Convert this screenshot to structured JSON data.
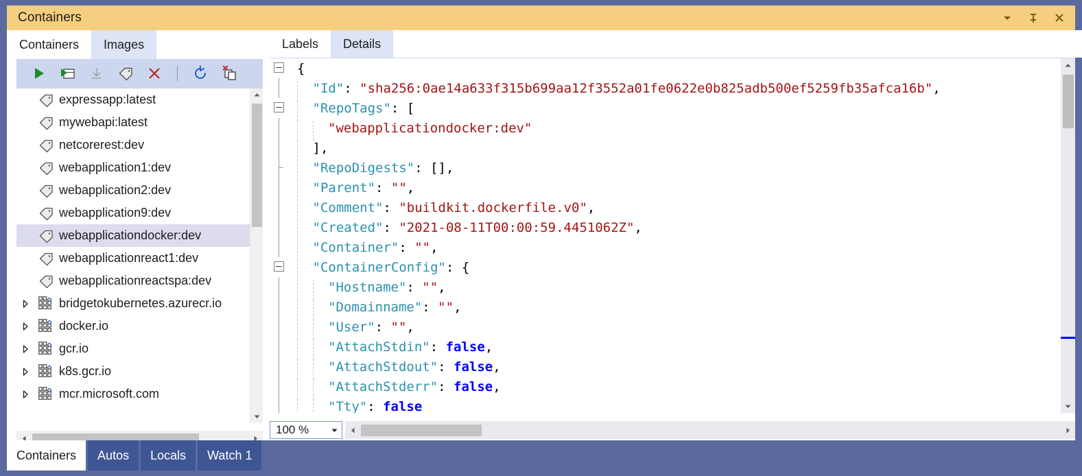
{
  "window": {
    "title": "Containers",
    "buttons": [
      {
        "name": "window-dropdown-button",
        "icon": "chevron-down-icon"
      },
      {
        "name": "window-pin-button",
        "icon": "pin-icon"
      },
      {
        "name": "window-close-button",
        "icon": "close-icon"
      }
    ]
  },
  "left_panel": {
    "tabs": [
      {
        "label": "Containers",
        "selected": false
      },
      {
        "label": "Images",
        "selected": true
      }
    ],
    "toolbar": [
      {
        "name": "run-button",
        "icon": "play-icon",
        "enabled": true
      },
      {
        "name": "open-in-browser-button",
        "icon": "window-play-icon",
        "enabled": true
      },
      {
        "name": "pull-button",
        "icon": "download-icon",
        "enabled": false
      },
      {
        "name": "tag-button",
        "icon": "tag-icon",
        "enabled": true
      },
      {
        "name": "remove-button",
        "icon": "close-x-icon",
        "enabled": true
      },
      {
        "name": "refresh-button",
        "icon": "refresh-icon",
        "enabled": true
      },
      {
        "name": "prune-images-button",
        "icon": "prune-images-icon",
        "enabled": true
      }
    ],
    "tree": [
      {
        "label": "expressapp:latest",
        "icon": "tag-icon",
        "type": "image",
        "expandable": false,
        "selected": false
      },
      {
        "label": "mywebapi:latest",
        "icon": "tag-icon",
        "type": "image",
        "expandable": false,
        "selected": false
      },
      {
        "label": "netcorerest:dev",
        "icon": "tag-icon",
        "type": "image",
        "expandable": false,
        "selected": false
      },
      {
        "label": "webapplication1:dev",
        "icon": "tag-icon",
        "type": "image",
        "expandable": false,
        "selected": false
      },
      {
        "label": "webapplication2:dev",
        "icon": "tag-icon",
        "type": "image",
        "expandable": false,
        "selected": false
      },
      {
        "label": "webapplication9:dev",
        "icon": "tag-icon",
        "type": "image",
        "expandable": false,
        "selected": false
      },
      {
        "label": "webapplicationdocker:dev",
        "icon": "tag-icon",
        "type": "image",
        "expandable": false,
        "selected": true
      },
      {
        "label": "webapplicationreact1:dev",
        "icon": "tag-icon",
        "type": "image",
        "expandable": false,
        "selected": false
      },
      {
        "label": "webapplicationreactspa:dev",
        "icon": "tag-icon",
        "type": "image",
        "expandable": false,
        "selected": false
      },
      {
        "label": "bridgetokubernetes.azurecr.io",
        "icon": "registry-icon",
        "type": "registry",
        "expandable": true,
        "selected": false
      },
      {
        "label": "docker.io",
        "icon": "registry-icon",
        "type": "registry",
        "expandable": true,
        "selected": false
      },
      {
        "label": "gcr.io",
        "icon": "registry-icon",
        "type": "registry",
        "expandable": true,
        "selected": false
      },
      {
        "label": "k8s.gcr.io",
        "icon": "registry-icon",
        "type": "registry",
        "expandable": true,
        "selected": false
      },
      {
        "label": "mcr.microsoft.com",
        "icon": "registry-icon",
        "type": "registry",
        "expandable": true,
        "selected": false
      }
    ]
  },
  "right_panel": {
    "tabs": [
      {
        "label": "Labels",
        "selected": false
      },
      {
        "label": "Details",
        "selected": true
      }
    ],
    "zoom_level": "100 %",
    "code_lines": [
      {
        "fold": "open",
        "indent": 0,
        "tokens": [
          {
            "t": "{",
            "c": "p"
          }
        ]
      },
      {
        "fold": "line",
        "indent": 1,
        "tokens": [
          {
            "t": "\"Id\"",
            "c": "k"
          },
          {
            "t": ": ",
            "c": "p"
          },
          {
            "t": "\"sha256:0ae14a633f315b699aa12f3552a01fe0622e0b825adb500ef5259fb35afca16b\"",
            "c": "s"
          },
          {
            "t": ",",
            "c": "p"
          }
        ]
      },
      {
        "fold": "open",
        "indent": 1,
        "tokens": [
          {
            "t": "\"RepoTags\"",
            "c": "k"
          },
          {
            "t": ": [",
            "c": "p"
          }
        ]
      },
      {
        "fold": "line",
        "indent": 2,
        "tokens": [
          {
            "t": "\"webapplicationdocker:dev\"",
            "c": "s"
          }
        ]
      },
      {
        "fold": "line",
        "indent": 1,
        "tokens": [
          {
            "t": "],",
            "c": "p"
          }
        ]
      },
      {
        "fold": "stub",
        "indent": 1,
        "tokens": [
          {
            "t": "\"RepoDigests\"",
            "c": "k"
          },
          {
            "t": ": [],",
            "c": "p"
          }
        ]
      },
      {
        "fold": "line",
        "indent": 1,
        "tokens": [
          {
            "t": "\"Parent\"",
            "c": "k"
          },
          {
            "t": ": ",
            "c": "p"
          },
          {
            "t": "\"\"",
            "c": "s"
          },
          {
            "t": ",",
            "c": "p"
          }
        ]
      },
      {
        "fold": "line",
        "indent": 1,
        "tokens": [
          {
            "t": "\"Comment\"",
            "c": "k"
          },
          {
            "t": ": ",
            "c": "p"
          },
          {
            "t": "\"buildkit.dockerfile.v0\"",
            "c": "s"
          },
          {
            "t": ",",
            "c": "p"
          }
        ]
      },
      {
        "fold": "line",
        "indent": 1,
        "tokens": [
          {
            "t": "\"Created\"",
            "c": "k"
          },
          {
            "t": ": ",
            "c": "p"
          },
          {
            "t": "\"2021-08-11T00:00:59.4451062Z\"",
            "c": "s"
          },
          {
            "t": ",",
            "c": "p"
          }
        ]
      },
      {
        "fold": "line",
        "indent": 1,
        "tokens": [
          {
            "t": "\"Container\"",
            "c": "k"
          },
          {
            "t": ": ",
            "c": "p"
          },
          {
            "t": "\"\"",
            "c": "s"
          },
          {
            "t": ",",
            "c": "p"
          }
        ]
      },
      {
        "fold": "open",
        "indent": 1,
        "tokens": [
          {
            "t": "\"ContainerConfig\"",
            "c": "k"
          },
          {
            "t": ": {",
            "c": "p"
          }
        ]
      },
      {
        "fold": "line",
        "indent": 2,
        "tokens": [
          {
            "t": "\"Hostname\"",
            "c": "k"
          },
          {
            "t": ": ",
            "c": "p"
          },
          {
            "t": "\"\"",
            "c": "s"
          },
          {
            "t": ",",
            "c": "p"
          }
        ]
      },
      {
        "fold": "line",
        "indent": 2,
        "tokens": [
          {
            "t": "\"Domainname\"",
            "c": "k"
          },
          {
            "t": ": ",
            "c": "p"
          },
          {
            "t": "\"\"",
            "c": "s"
          },
          {
            "t": ",",
            "c": "p"
          }
        ]
      },
      {
        "fold": "line",
        "indent": 2,
        "tokens": [
          {
            "t": "\"User\"",
            "c": "k"
          },
          {
            "t": ": ",
            "c": "p"
          },
          {
            "t": "\"\"",
            "c": "s"
          },
          {
            "t": ",",
            "c": "p"
          }
        ]
      },
      {
        "fold": "line",
        "indent": 2,
        "tokens": [
          {
            "t": "\"AttachStdin\"",
            "c": "k"
          },
          {
            "t": ": ",
            "c": "p"
          },
          {
            "t": "false",
            "c": "b"
          },
          {
            "t": ",",
            "c": "p"
          }
        ]
      },
      {
        "fold": "line",
        "indent": 2,
        "tokens": [
          {
            "t": "\"AttachStdout\"",
            "c": "k"
          },
          {
            "t": ": ",
            "c": "p"
          },
          {
            "t": "false",
            "c": "b"
          },
          {
            "t": ",",
            "c": "p"
          }
        ]
      },
      {
        "fold": "line",
        "indent": 2,
        "tokens": [
          {
            "t": "\"AttachStderr\"",
            "c": "k"
          },
          {
            "t": ": ",
            "c": "p"
          },
          {
            "t": "false",
            "c": "b"
          },
          {
            "t": ",",
            "c": "p"
          }
        ]
      },
      {
        "fold": "line",
        "indent": 2,
        "tokens": [
          {
            "t": "\"Tty\"",
            "c": "k"
          },
          {
            "t": ": ",
            "c": "p"
          },
          {
            "t": "false",
            "c": "b"
          }
        ]
      }
    ]
  },
  "bottom_tabs": [
    {
      "label": "Containers",
      "selected": true
    },
    {
      "label": "Autos",
      "selected": false
    },
    {
      "label": "Locals",
      "selected": false
    },
    {
      "label": "Watch 1",
      "selected": false
    }
  ]
}
